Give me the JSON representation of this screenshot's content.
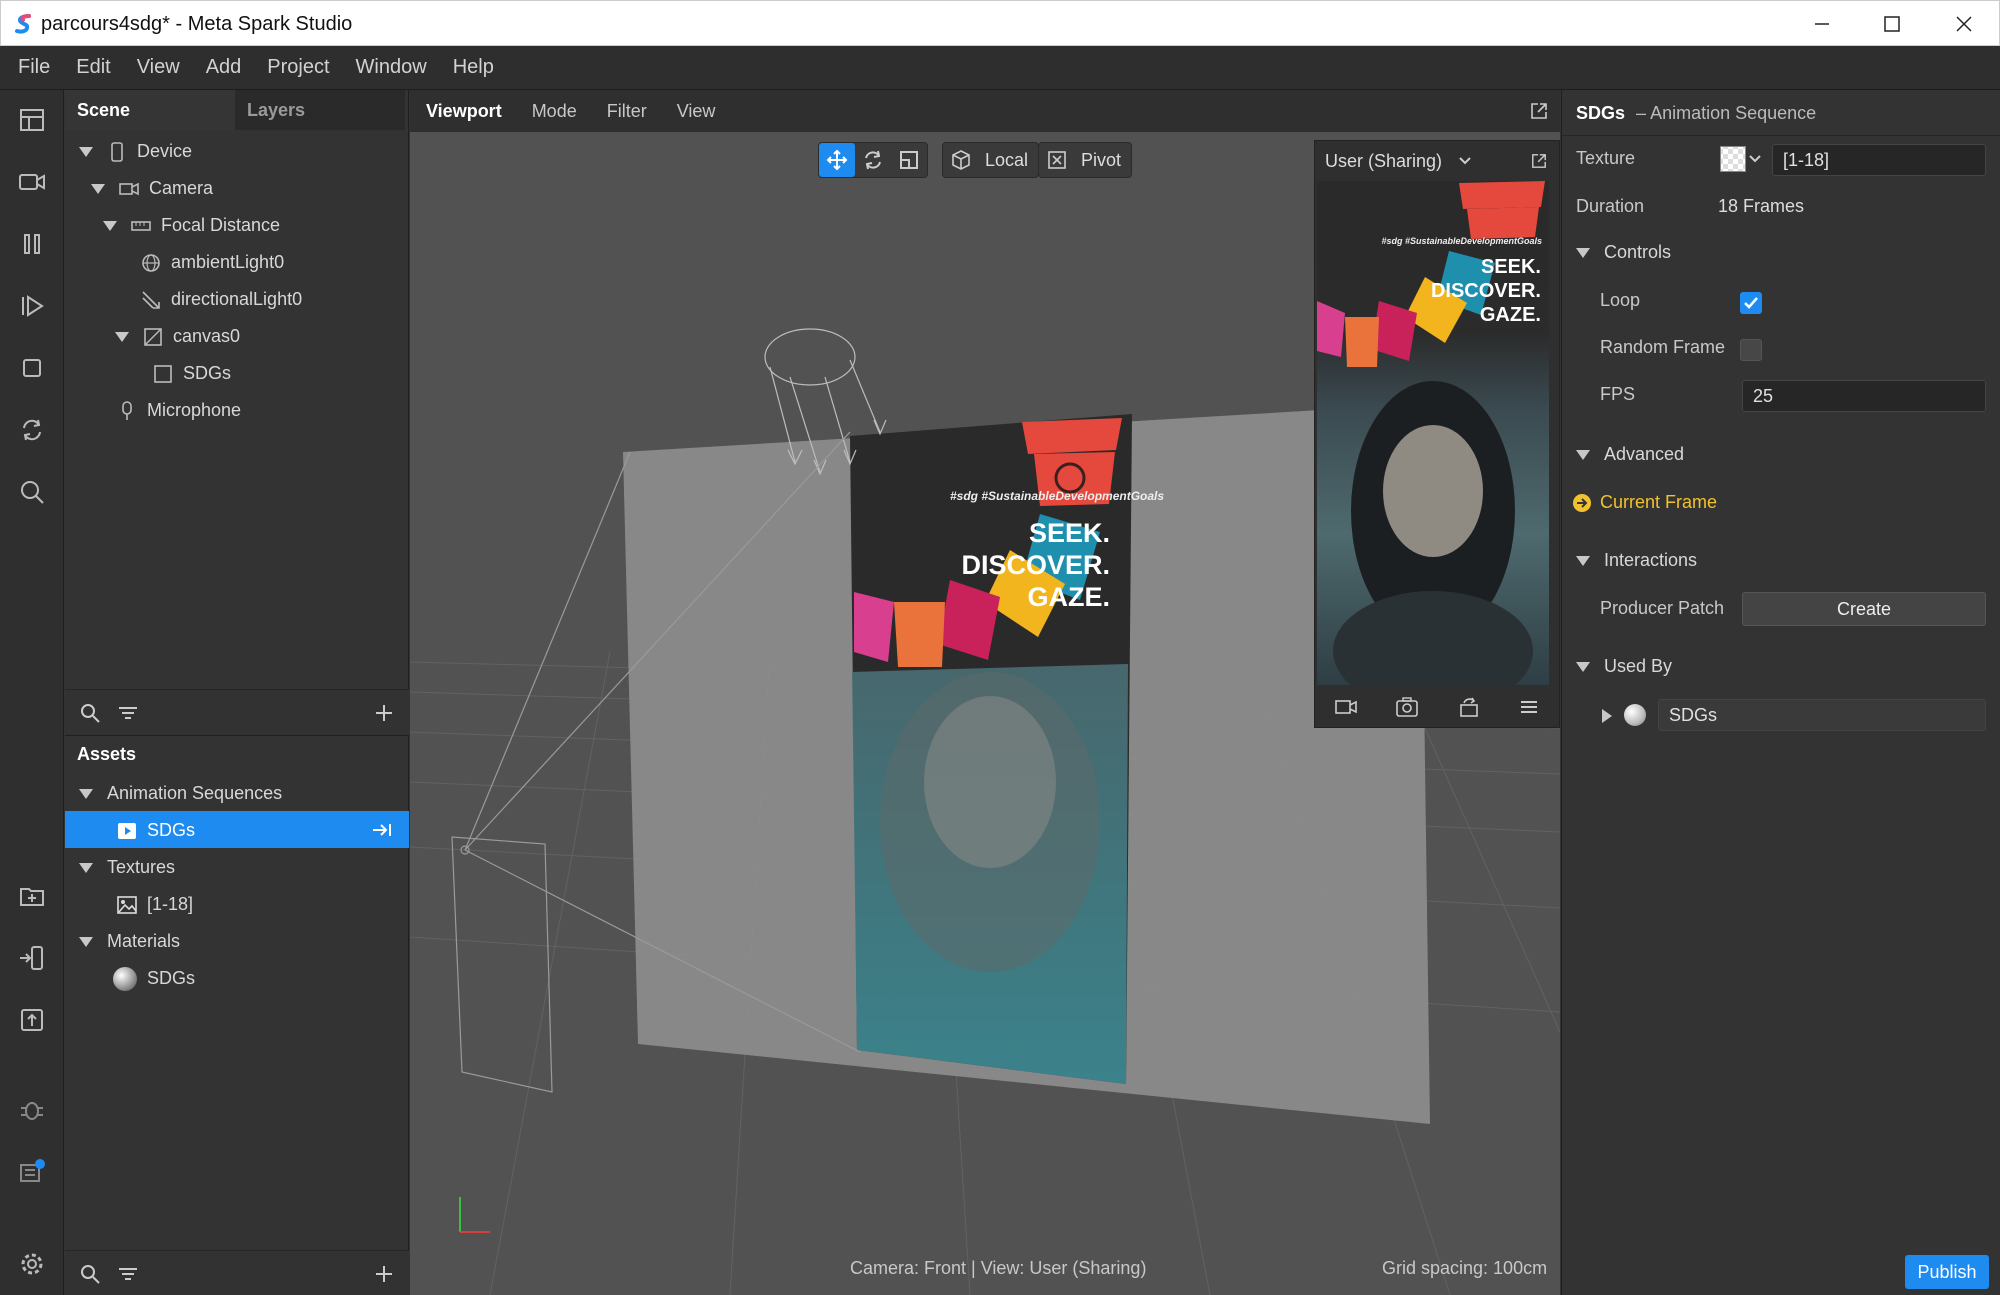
{
  "window": {
    "title": "parcours4sdg* - Meta Spark Studio"
  },
  "menu": [
    "File",
    "Edit",
    "View",
    "Add",
    "Project",
    "Window",
    "Help"
  ],
  "scene": {
    "tabs": [
      "Scene",
      "Layers"
    ],
    "tree": [
      {
        "label": "Device",
        "icon": "phone-icon"
      },
      {
        "label": "Camera",
        "icon": "camera-icon"
      },
      {
        "label": "Focal Distance",
        "icon": "ruler-icon"
      },
      {
        "label": "ambientLight0",
        "icon": "globe-icon"
      },
      {
        "label": "directionalLight0",
        "icon": "directional-light-icon"
      },
      {
        "label": "canvas0",
        "icon": "canvas-icon"
      },
      {
        "label": "SDGs",
        "icon": "rectangle-icon"
      },
      {
        "label": "Microphone",
        "icon": "microphone-icon"
      }
    ]
  },
  "assets": {
    "title": "Assets",
    "groups": [
      {
        "label": "Animation Sequences",
        "items": [
          "SDGs"
        ]
      },
      {
        "label": "Textures",
        "items": [
          "[1-18]"
        ]
      },
      {
        "label": "Materials",
        "items": [
          "SDGs"
        ]
      }
    ]
  },
  "viewport": {
    "tabs": [
      "Viewport",
      "Mode",
      "Filter",
      "View"
    ],
    "toolbar": {
      "local": "Local",
      "pivot": "Pivot"
    },
    "preview_title": "User (Sharing)",
    "poster_hashtags": "#sdg #SustainableDevelopmentGoals",
    "poster_lines": [
      "SEEK.",
      "DISCOVER.",
      "GAZE."
    ],
    "status_camera": "Camera: Front | View: User (Sharing)",
    "status_grid": "Grid spacing: 100cm"
  },
  "inspector": {
    "object_name": "SDGs",
    "object_type": "– Animation Sequence",
    "texture_label": "Texture",
    "texture_value": "[1-18]",
    "duration_label": "Duration",
    "duration_value": "18 Frames",
    "controls_header": "Controls",
    "loop_label": "Loop",
    "loop_checked": true,
    "random_frame_label": "Random Frame",
    "random_frame_checked": false,
    "fps_label": "FPS",
    "fps_value": "25",
    "advanced_header": "Advanced",
    "current_frame_label": "Current Frame",
    "interactions_header": "Interactions",
    "producer_patch_label": "Producer Patch",
    "create_label": "Create",
    "used_by_header": "Used By",
    "used_by_item": "SDGs"
  },
  "publish_label": "Publish",
  "colors": {
    "accent": "#1e8bf0",
    "current_frame": "#f2c12e"
  }
}
